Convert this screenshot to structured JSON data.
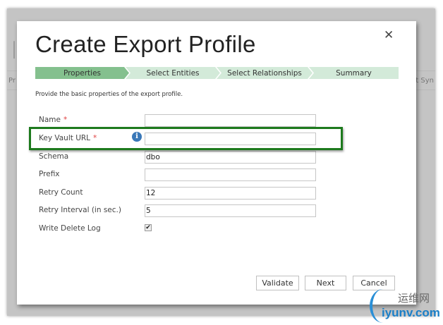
{
  "background": {
    "title_fragment": "I",
    "left_fragment": "Pr",
    "right_fragment": "st Syn"
  },
  "dialog": {
    "title": "Create Export Profile",
    "close_icon": "close-icon",
    "steps": [
      "Properties",
      "Select Entities",
      "Select Relationships",
      "Summary"
    ],
    "active_step": "Properties",
    "description": "Provide the basic properties of the export profile.",
    "fields": [
      {
        "label": "Name",
        "required": "*",
        "value": ""
      },
      {
        "label": "Key Vault URL",
        "required": "*",
        "value": ""
      },
      {
        "label": "Schema",
        "value": "dbo"
      },
      {
        "label": "Prefix",
        "value": ""
      },
      {
        "label": "Retry Count",
        "value": "12"
      },
      {
        "label": "Retry Interval (in sec.)",
        "value": "5"
      },
      {
        "label": "Write Delete Log",
        "checked": true
      }
    ],
    "info_icon": "i",
    "buttons": {
      "validate": "Validate",
      "next": "Next",
      "cancel": "Cancel"
    },
    "colors": {
      "active_step": "#84c08e",
      "inactive_step": "#d3ead9",
      "highlight": "#1d7a1d",
      "info": "#3a78b8"
    }
  },
  "watermark": {
    "cn": "运维网",
    "en": "iyunv.com"
  }
}
